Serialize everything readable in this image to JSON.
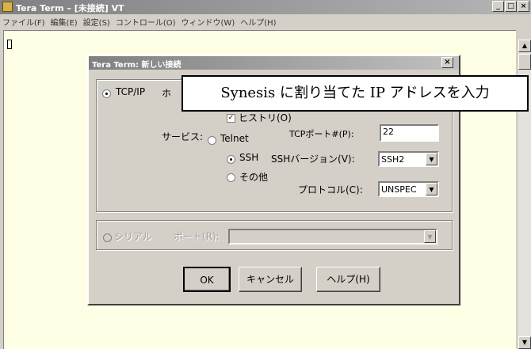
{
  "window": {
    "title": "Tera Term – [未接続] VT",
    "controls": [
      "_",
      "□",
      "×"
    ]
  },
  "menu": [
    "ファイル(F)",
    "編集(E)",
    "設定(S)",
    "コントロール(O)",
    "ウィンドウ(W)",
    "ヘルプ(H)"
  ],
  "dialog": {
    "title": "Tera Term: 新しい接続",
    "close": "×",
    "tcpip": {
      "label": "TCP/IP",
      "host_label_partial": "ホ"
    },
    "history": {
      "label": "ヒストリ(O)",
      "checked": true
    },
    "service_label": "サービス:",
    "telnet": "Telnet",
    "ssh": "SSH",
    "other": "その他",
    "tcp_port_label": "TCPポート#(P):",
    "tcp_port_value": "22",
    "ssh_version_label": "SSHバージョン(V):",
    "ssh_version_value": "SSH2",
    "protocol_label": "プロトコル(C):",
    "protocol_value": "UNSPEC",
    "serial_label": "シリアル",
    "port_label": "ポート(R):",
    "buttons": {
      "ok": "OK",
      "cancel": "キャンセル",
      "help": "ヘルプ(H)"
    }
  },
  "callout": "Synesis に割り当てた IP アドレスを入力"
}
